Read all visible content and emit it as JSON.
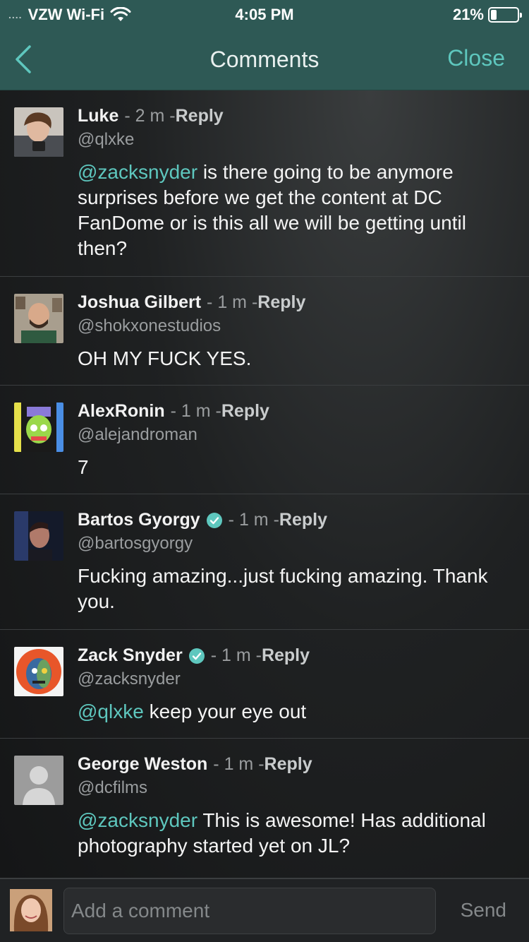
{
  "status_bar": {
    "carrier": "VZW Wi-Fi",
    "signal_dots": "....",
    "time": "4:05 PM",
    "battery_percent": "21%",
    "battery_level": 0.21
  },
  "header": {
    "title": "Comments",
    "close_label": "Close",
    "back_icon": "chevron-left-icon",
    "accent_color": "#5ec7be",
    "background_color": "#2e5955"
  },
  "comments": [
    {
      "name": "Luke",
      "time": "2 m",
      "reply": "Reply",
      "handle": "@qlxke",
      "verified": false,
      "mention": "@zacksnyder",
      "text": " is there going to be anymore surprises before we get the content at DC FanDome or is this all we will be getting until then?"
    },
    {
      "name": "Joshua Gilbert",
      "time": "1 m",
      "reply": "Reply",
      "handle": "@shokxonestudios",
      "verified": false,
      "mention": "",
      "text": "OH MY FUCK YES."
    },
    {
      "name": "AlexRonin",
      "time": "1 m",
      "reply": "Reply",
      "handle": "@alejandroman",
      "verified": false,
      "mention": "",
      "text": "7"
    },
    {
      "name": "Bartos Gyorgy",
      "time": "1 m",
      "reply": "Reply",
      "handle": "@bartosgyorgy",
      "verified": true,
      "mention": "",
      "text": "Fucking amazing...just fucking amazing. Thank you."
    },
    {
      "name": "Zack Snyder",
      "time": "1 m",
      "reply": "Reply",
      "handle": "@zacksnyder",
      "verified": true,
      "mention": "@qlxke",
      "text": " keep your eye out"
    },
    {
      "name": "George Weston",
      "time": "1 m",
      "reply": "Reply",
      "handle": "@dcfilms",
      "verified": false,
      "mention": "@zacksnyder",
      "text": " This is awesome! Has additional photography started yet on JL?"
    }
  ],
  "composer": {
    "placeholder": "Add a comment",
    "send_label": "Send"
  },
  "separator": " - "
}
